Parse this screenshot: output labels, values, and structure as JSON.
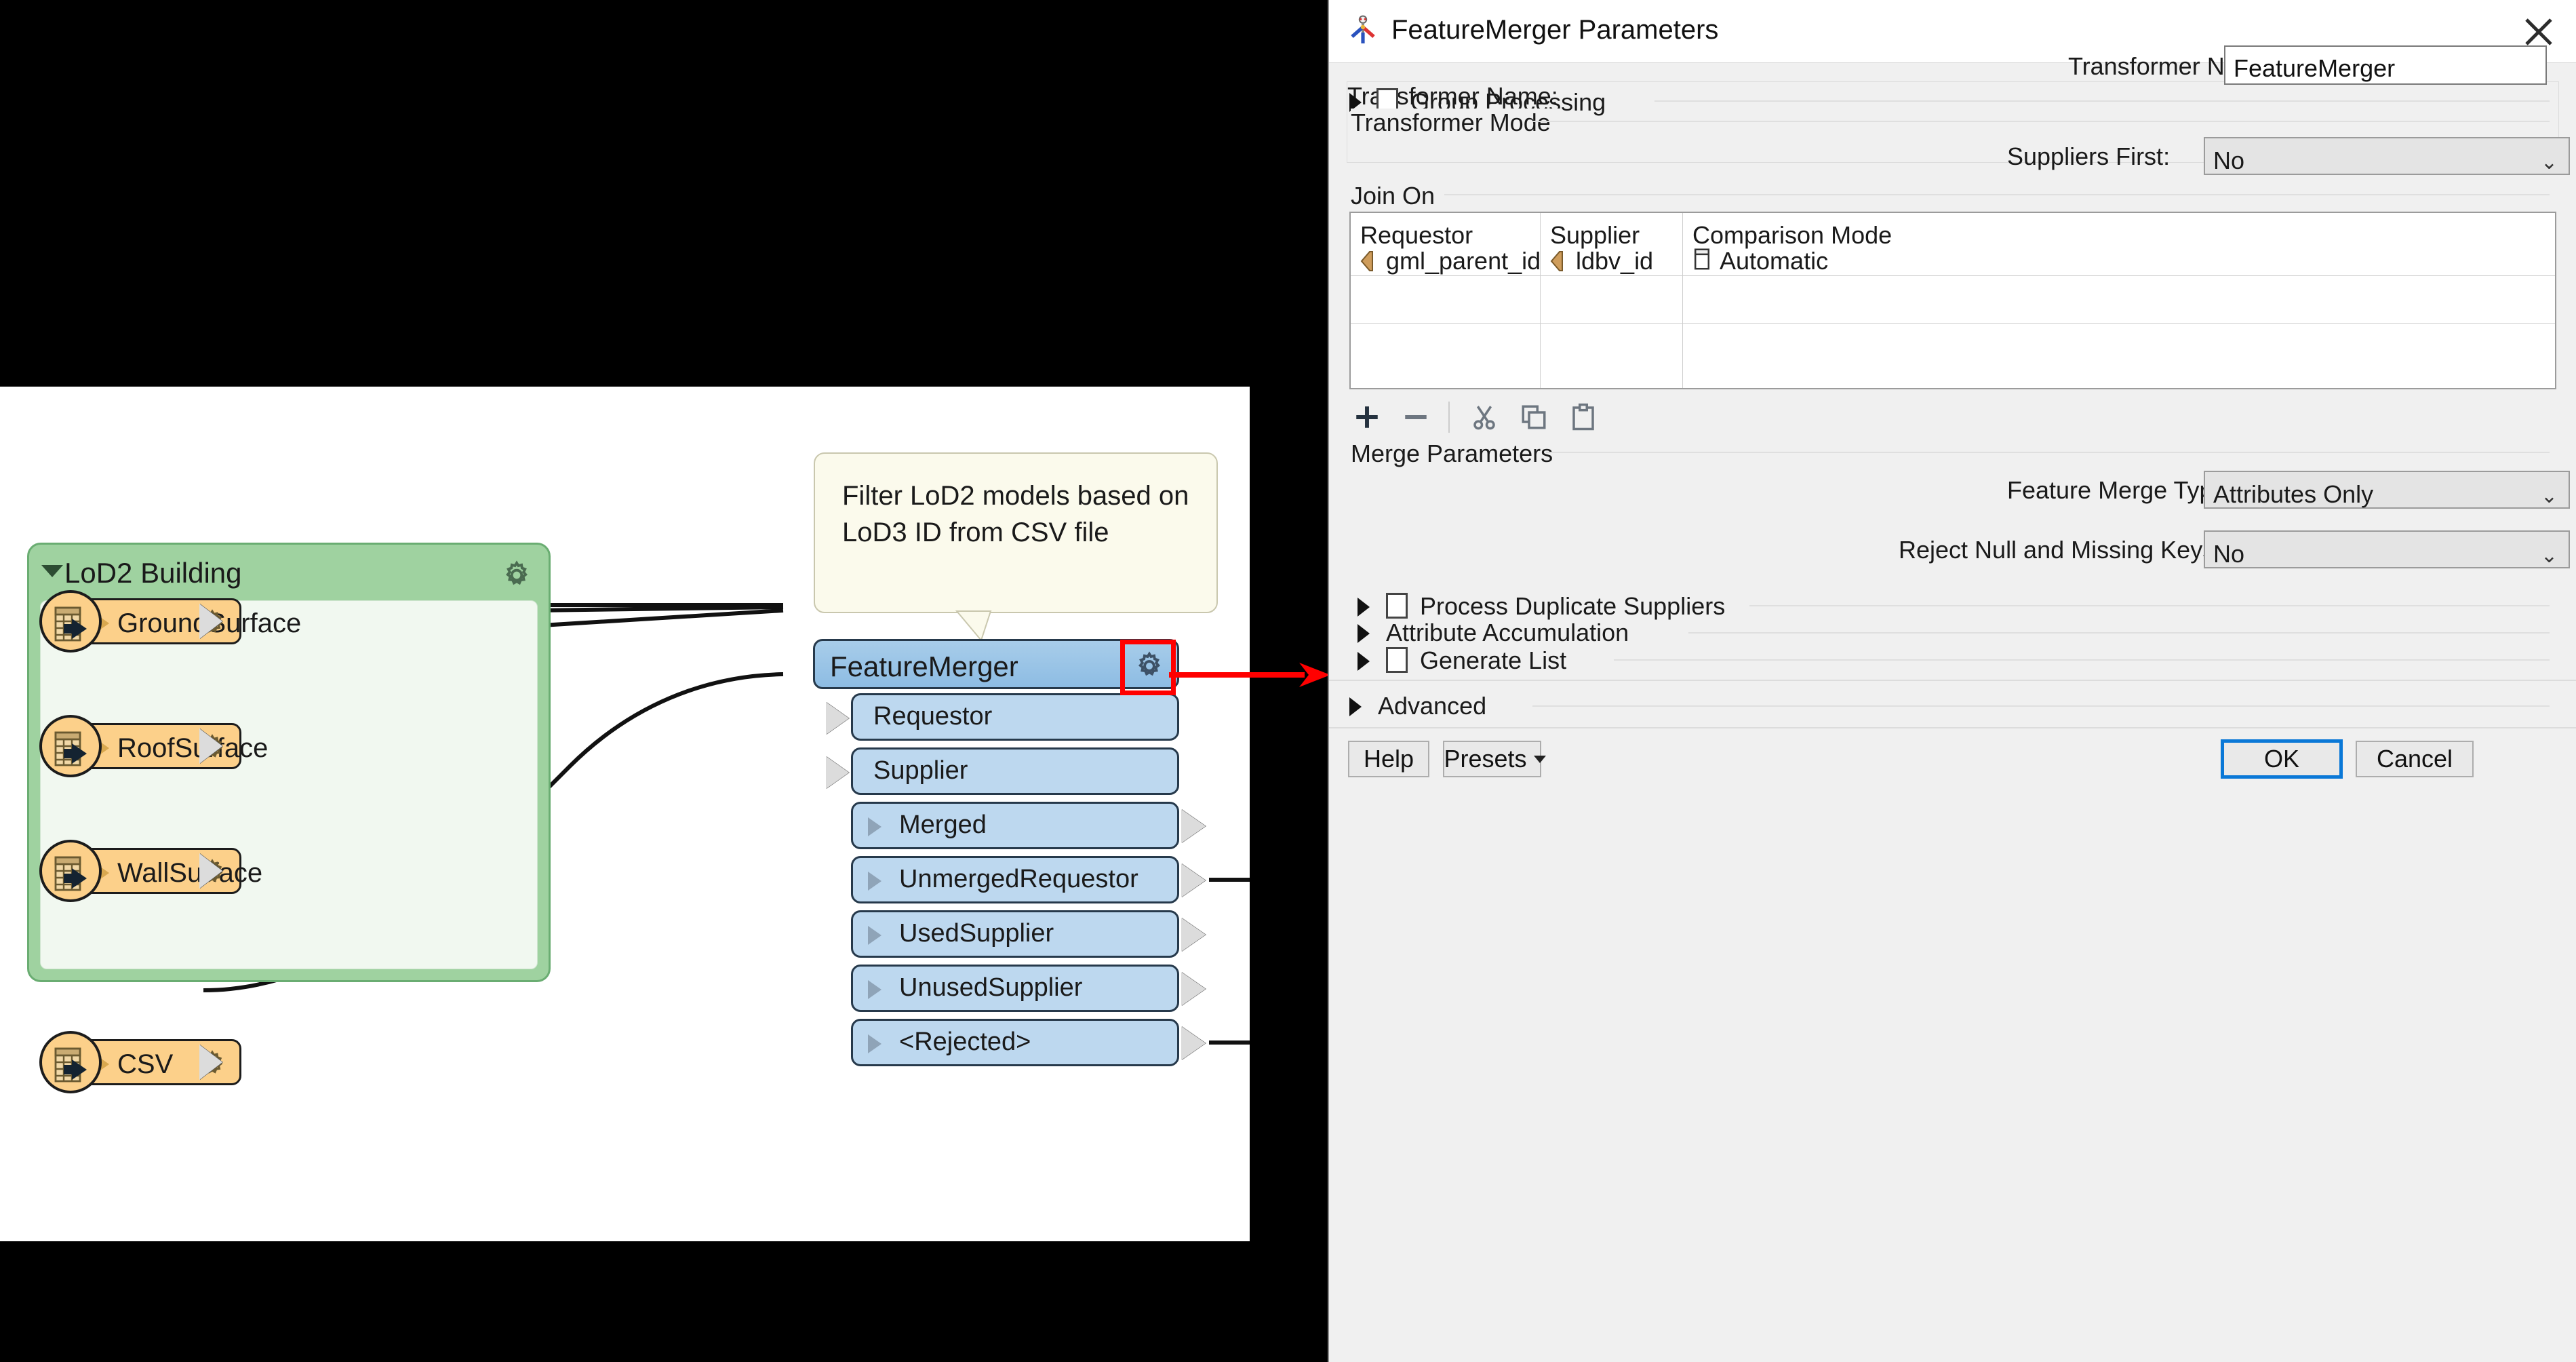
{
  "canvas": {
    "group": {
      "title": "LoD2 Building",
      "caret_icon": "triangle-down-icon",
      "gear_icon": "gear-icon",
      "nodes": [
        {
          "label": "GroundSurface",
          "icon": "table-reader-icon",
          "gear_icon": "gear-icon"
        },
        {
          "label": "RoofSurface",
          "icon": "table-reader-icon",
          "gear_icon": "gear-icon"
        },
        {
          "label": "WallSurface",
          "icon": "table-reader-icon",
          "gear_icon": "gear-icon"
        }
      ]
    },
    "csv_node": {
      "label": "CSV",
      "icon": "table-reader-icon",
      "gear_icon": "gear-icon"
    },
    "annotation": {
      "text": "Filter LoD2 models based on LoD3 ID from CSV file"
    },
    "transformer": {
      "title": "FeatureMerger",
      "gear_icon": "gear-icon",
      "highlight_color": "#ff0000",
      "input_ports": [
        "Requestor",
        "Supplier"
      ],
      "output_ports": [
        "Merged",
        "UnmergedRequestor",
        "UsedSupplier",
        "UnusedSupplier",
        "<Rejected>"
      ]
    },
    "pointer": {
      "icon": "red-arrow-icon",
      "color": "#ff0000"
    }
  },
  "dialog": {
    "title": "FeatureMerger Parameters",
    "title_icon": "feature-merger-icon",
    "close_icon": "close-icon",
    "transformer_name": {
      "label": "Transformer Name:",
      "value": "FeatureMerger"
    },
    "group_processing": {
      "label": "Group Processing",
      "expand_icon": "triangle-right-icon",
      "checked": false
    },
    "transformer_mode": {
      "section_title": "Transformer Mode",
      "suppliers_first": {
        "label": "Suppliers First:",
        "value": "No",
        "dropdown_icon": "chevron-down-icon"
      }
    },
    "join_on": {
      "section_title": "Join On",
      "columns": [
        "Requestor",
        "Supplier",
        "Comparison Mode"
      ],
      "rows": [
        {
          "requestor": "gml_parent_id",
          "requestor_icon": "attribute-icon",
          "supplier": "ldbv_id",
          "supplier_icon": "attribute-icon",
          "comparison_mode": "Automatic",
          "comparison_icon": "mode-icon"
        },
        {
          "requestor": "",
          "supplier": "",
          "comparison_mode": ""
        }
      ],
      "toolbar": [
        {
          "name": "add-row-button",
          "icon": "plus-icon"
        },
        {
          "name": "remove-row-button",
          "icon": "minus-icon"
        },
        {
          "name": "cut-button",
          "icon": "scissors-icon"
        },
        {
          "name": "copy-button",
          "icon": "copy-icon"
        },
        {
          "name": "paste-button",
          "icon": "paste-icon"
        }
      ]
    },
    "merge_parameters": {
      "section_title": "Merge Parameters",
      "feature_merge_type": {
        "label": "Feature Merge Type:",
        "value": "Attributes Only",
        "dropdown_icon": "chevron-down-icon"
      },
      "reject_null_missing": {
        "label": "Reject Null and Missing Keys:",
        "value": "No",
        "dropdown_icon": "chevron-down-icon"
      },
      "process_duplicate_suppliers": {
        "label": "Process Duplicate Suppliers",
        "expand_icon": "triangle-right-icon",
        "checked": false
      },
      "attribute_accumulation": {
        "label": "Attribute Accumulation",
        "expand_icon": "triangle-right-icon"
      },
      "generate_list": {
        "label": "Generate List",
        "expand_icon": "triangle-right-icon",
        "checked": false
      }
    },
    "advanced": {
      "label": "Advanced",
      "expand_icon": "triangle-right-icon"
    },
    "footer": {
      "help": "Help",
      "presets": "Presets",
      "presets_icon": "presets-icon",
      "presets_caret": "triangle-down-icon",
      "ok": "OK",
      "cancel": "Cancel"
    }
  }
}
